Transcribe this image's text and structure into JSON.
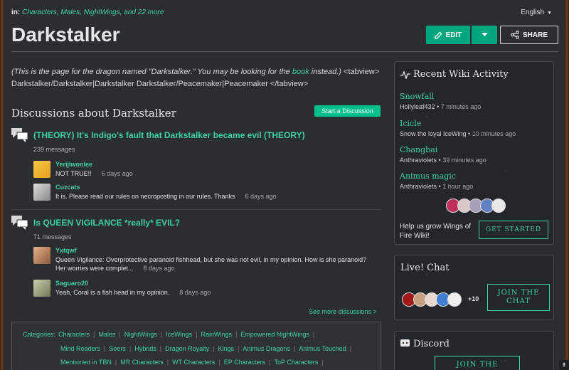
{
  "breadcrumb": {
    "prefix": "in:",
    "links": "Characters, Males, NightWings, and 22 more"
  },
  "language": {
    "label": "English"
  },
  "page": {
    "title": "Darkstalker"
  },
  "actions": {
    "edit": "EDIT",
    "share": "SHARE"
  },
  "intro": {
    "part1": "(This is the page for the dragon named \"Darkstalker.\" You may be looking for the ",
    "link": "book",
    "part2": " instead.)",
    "part3": " <tabview> Darkstalker/Darkstalker|Darkstalker Darkstalker/Peacemaker|Peacemaker </tabview>"
  },
  "discussions": {
    "heading": "Discussions about Darkstalker",
    "start_button": "Start a Discussion",
    "see_more": "See more discussions >",
    "threads": [
      {
        "title": "(THEORY) It's Indigo's fault that Darkstalker became evil (THEORY)",
        "count": "239 messages",
        "posts": [
          {
            "user": "Yerijiwonlee",
            "text": "NOT TRUE!!",
            "time": "6 days ago"
          },
          {
            "user": "Cuzcats",
            "text": "It is. Please read our rules on necroposting in our rules. Thanks",
            "time": "6 days ago"
          }
        ]
      },
      {
        "title": "Is QUEEN VIGILANCE *really* EVIL?",
        "count": "71 messages",
        "posts": [
          {
            "user": "Yxtqwf",
            "text": "Queen Vigilance: Overprotective paranoid fishhead, but she was not evil, in my opinion. How is she paranoid? Her worries were complet...",
            "time": "8 days ago"
          },
          {
            "user": "Saguaro20",
            "text": "Yeah, Coral is a fish head in my opinion.",
            "time": "8 days ago"
          }
        ]
      }
    ]
  },
  "categories": {
    "label": "Categories:",
    "row1": [
      "Characters",
      "Males",
      "NightWings",
      "IceWings",
      "RainWings",
      "Empowered NightWings"
    ],
    "row2": [
      "Mind Readers",
      "Seers",
      "Hybrids",
      "Dragon Royalty",
      "Kings",
      "Animus Dragons",
      "Animus Touched"
    ],
    "row3": [
      "Mentioned in TBN",
      "MR Characters",
      "WT Characters",
      "EP Characters",
      "ToP Characters"
    ]
  },
  "activity": {
    "title": "Recent Wiki Activity",
    "items": [
      {
        "name": "Snowfall",
        "user": "Hollyleaf432",
        "time": "7 minutes ago"
      },
      {
        "name": "Icicle",
        "user": "Snow the loyal IceWing",
        "time": "10 minutes ago"
      },
      {
        "name": "Changbai",
        "user": "Anthraviolets",
        "time": "39 minutes ago"
      },
      {
        "name": "Animus magic",
        "user": "Anthraviolets",
        "time": "1 hour ago"
      }
    ],
    "grow_text": "Help us grow Wings of Fire Wiki!",
    "get_started": "GET STARTED"
  },
  "chat": {
    "title": "Live! Chat",
    "plus": "+10",
    "join": "JOIN THE CHAT"
  },
  "discord": {
    "title": "Discord",
    "join": "JOIN THE"
  },
  "colors": {
    "accent": "#3fd1a4",
    "button": "#00a67e",
    "bg": "#2b2e31"
  }
}
